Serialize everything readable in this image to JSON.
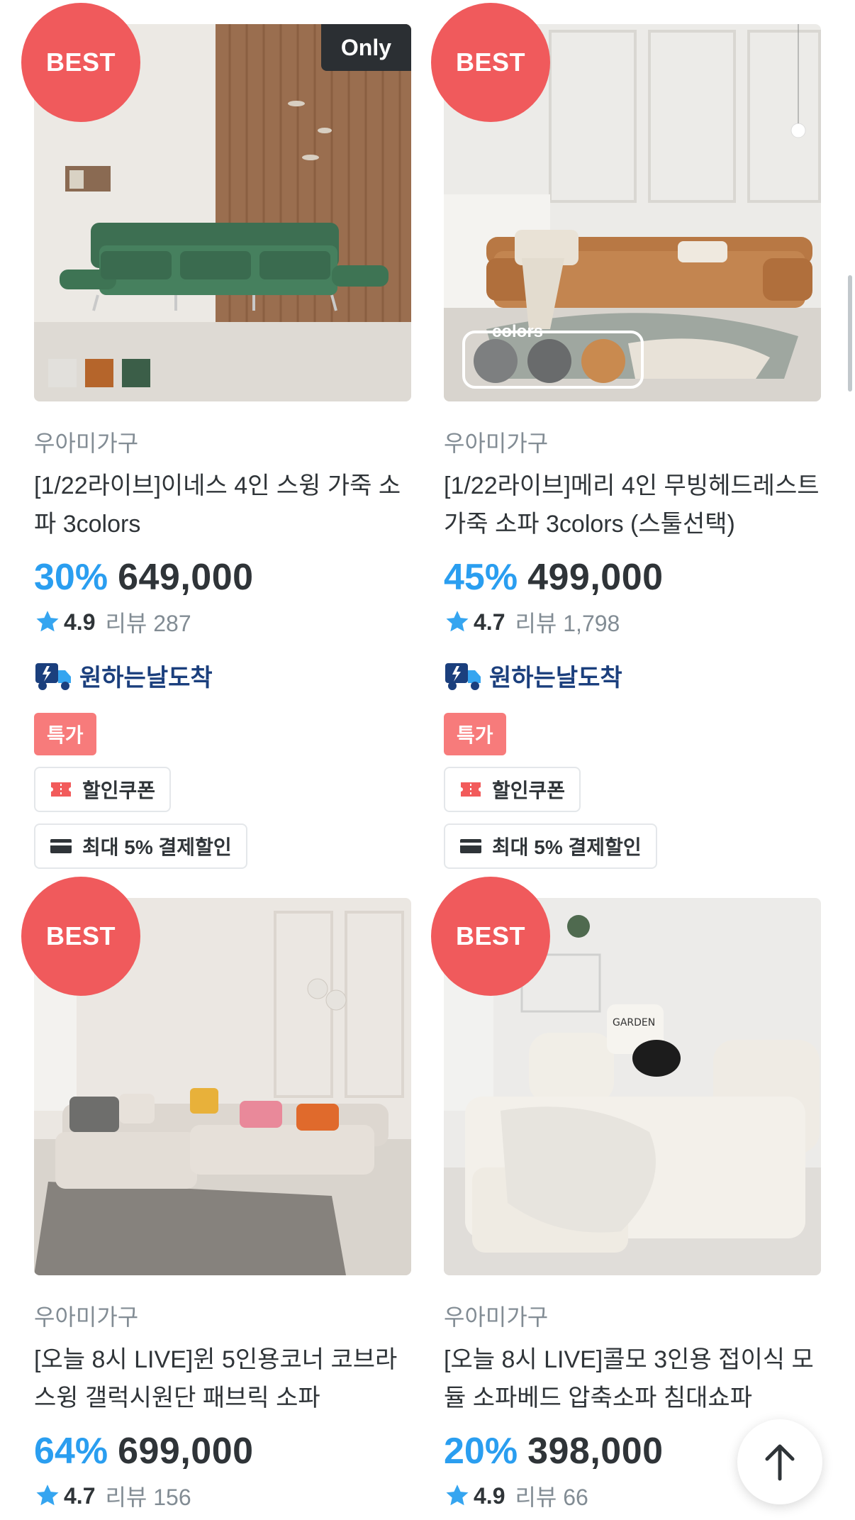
{
  "products": [
    {
      "best_label": "BEST",
      "only_label": "Only",
      "brand": "우아미가구",
      "title": "[1/22라이브]이네스 4인 스윙 가죽 소파 3colors",
      "discount": "30%",
      "price": "649,000",
      "rating": "4.9",
      "review": "리뷰 287",
      "delivery": "원하는날도착",
      "special": "특가",
      "coupon": "할인쿠폰",
      "payment": "최대 5% 결제할인",
      "swatches": [
        "#e2e0dc",
        "#b5652b",
        "#3b5e48"
      ]
    },
    {
      "best_label": "BEST",
      "brand": "우아미가구",
      "title": "[1/22라이브]메리 4인 무빙헤드레스트 가죽 소파 3colors (스툴선택)",
      "discount": "45%",
      "price": "499,000",
      "rating": "4.7",
      "review": "리뷰 1,798",
      "delivery": "원하는날도착",
      "special": "특가",
      "coupon": "할인쿠폰",
      "payment": "최대 5% 결제할인",
      "colors_label": "colors",
      "color_dots": [
        "#7d7f80",
        "#696b6c",
        "#c98a4f"
      ]
    },
    {
      "best_label": "BEST",
      "brand": "우아미가구",
      "title": "[오늘 8시 LIVE]윈 5인용코너 코브라 스윙 갤럭시원단 패브릭 소파",
      "discount": "64%",
      "price": "699,000",
      "rating": "4.7",
      "review": "리뷰 156"
    },
    {
      "best_label": "BEST",
      "brand": "우아미가구",
      "title": "[오늘 8시 LIVE]콜모 3인용 접이식 모듈 소파베드 압축소파 침대쇼파",
      "discount": "20%",
      "price": "398,000",
      "rating": "4.9",
      "review": "리뷰 66",
      "cushion_text": "GARDEN"
    }
  ],
  "colors": {
    "accent_blue": "#2a9ef0",
    "best_red": "#f05a5c",
    "special_red": "#f77b7b",
    "delivery_navy": "#1b3f7d"
  },
  "icons": {
    "star": "star-icon",
    "delivery": "truck-icon",
    "coupon": "coupon-icon",
    "payment": "credit-card-icon",
    "top": "arrow-up-icon"
  }
}
